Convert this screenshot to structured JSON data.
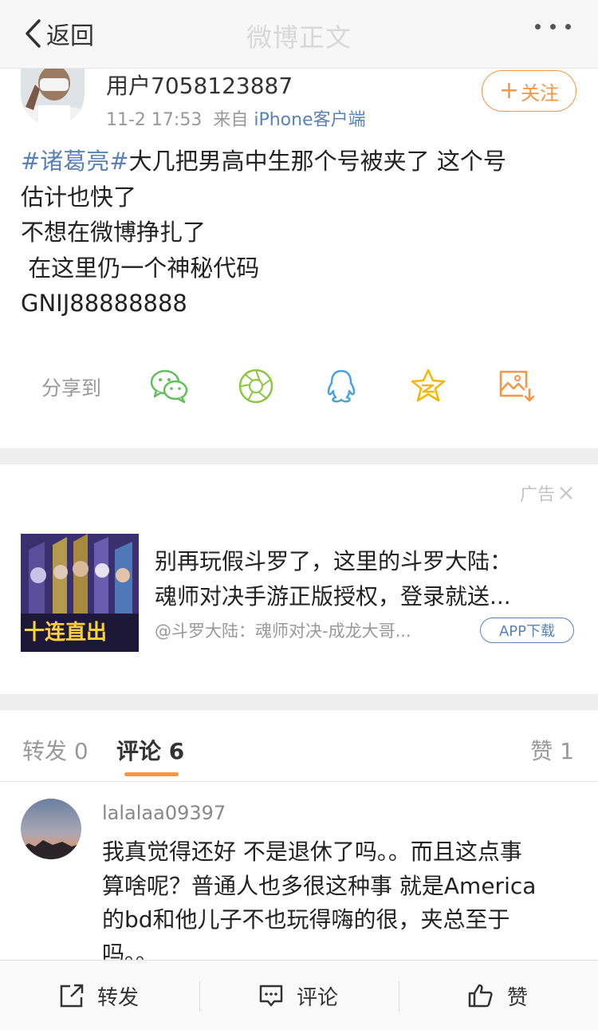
{
  "nav": {
    "back_label": "返回",
    "title": "微博正文"
  },
  "post": {
    "user_name": "用户7058123887",
    "time": "11-2 17:53",
    "from_prefix": "来自",
    "source": "iPhone客户端",
    "follow_label": "关注",
    "topic": "#诸葛亮#",
    "lines": [
      "大几把男高中生那个号被夹了 这个号",
      "估计也快了",
      "不想在微博挣扎了",
      " 在这里仍一个神秘代码",
      "GNIJ88888888"
    ]
  },
  "share": {
    "label": "分享到",
    "icons": [
      "wechat-icon",
      "moments-icon",
      "qq-icon",
      "qzone-icon",
      "save-image-icon"
    ]
  },
  "ad": {
    "label": "广告",
    "title_lines": [
      "别再玩假斗罗了，这里的斗罗大陆：",
      "魂师对决手游正版授权，登录就送..."
    ],
    "source": "@斗罗大陆：魂师对决-成龙大哥...",
    "button_label": "APP下载",
    "banner_text": "十连直出"
  },
  "tabs": {
    "repost": "转发 0",
    "comment": "评论 6",
    "like": "赞 1"
  },
  "comment": {
    "user": "lalalaa09397",
    "lines": [
      "我真觉得还好 不是退休了吗。。而且这点事",
      "算啥呢？普通人也多很这种事 就是America",
      "的bd和他儿子不也玩得嗨的很，夹总至于",
      "吗。。"
    ]
  },
  "bottom": {
    "repost": "转发",
    "comment": "评论",
    "like": "赞"
  },
  "colors": {
    "link_blue": "#5b82b4",
    "accent_orange": "#f49645"
  }
}
